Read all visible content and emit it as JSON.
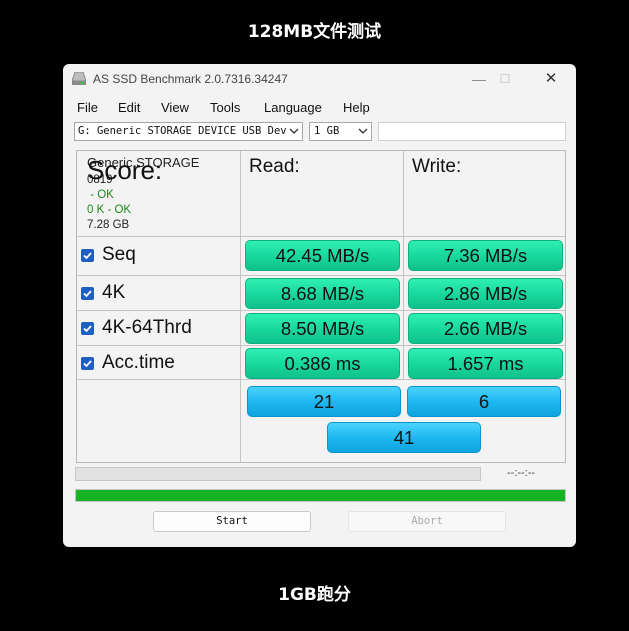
{
  "captions": {
    "top": "128MB文件测试",
    "bottom": "1GB跑分"
  },
  "window": {
    "title": "AS SSD Benchmark 2.0.7316.34247",
    "controls": {
      "minimize": "—",
      "maximize": "☐",
      "close": "✕"
    }
  },
  "menu": [
    "File",
    "Edit",
    "View",
    "Tools",
    "Language",
    "Help"
  ],
  "toolbar": {
    "device": "G: Generic STORAGE DEVICE USB Dev",
    "size": "1 GB",
    "extra": ""
  },
  "info": {
    "name": "Generic STORAGE",
    "firmware": "0819",
    "status1": " - OK",
    "status2": "0 K - OK",
    "capacity": "7.28 GB"
  },
  "headers": {
    "read": "Read:",
    "write": "Write:"
  },
  "tests": [
    {
      "label": "Seq",
      "checked": true,
      "read": "42.45 MB/s",
      "write": "7.36 MB/s"
    },
    {
      "label": "4K",
      "checked": true,
      "read": "8.68 MB/s",
      "write": "2.86 MB/s"
    },
    {
      "label": "4K-64Thrd",
      "checked": true,
      "read": "8.50 MB/s",
      "write": "2.66 MB/s"
    },
    {
      "label": "Acc.time",
      "checked": true,
      "read": "0.386 ms",
      "write": "1.657 ms"
    }
  ],
  "score": {
    "label": "Score:",
    "read": "21",
    "write": "6",
    "total": "41"
  },
  "status": {
    "time": "--:--:--",
    "progress_fraction": 1.0
  },
  "buttons": {
    "start": "Start",
    "abort": "Abort"
  },
  "colors": {
    "result": "#1ad69d",
    "score": "#1cb6ef",
    "progress": "#16b324",
    "checkbox": "#1f5fc2"
  }
}
